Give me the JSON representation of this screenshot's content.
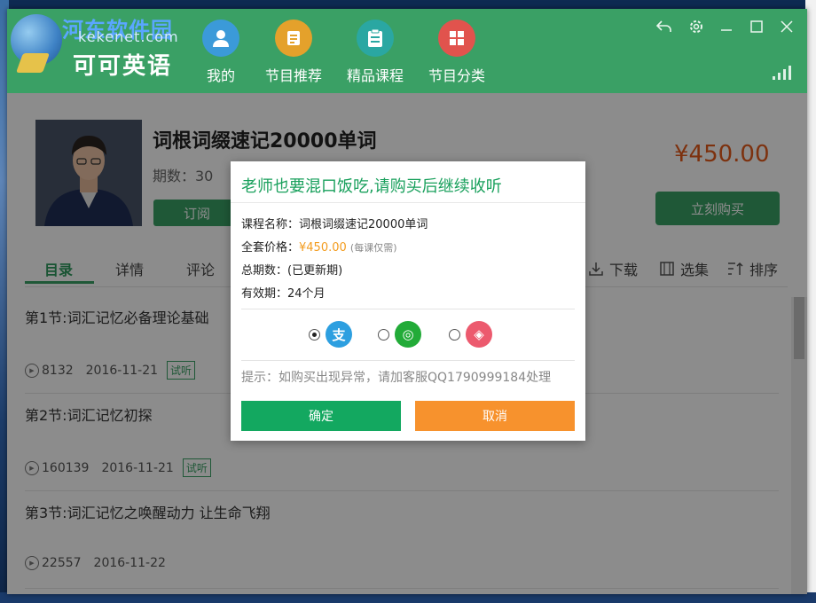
{
  "brand": {
    "site_name": "河东软件园",
    "site_url": "kekenet.com",
    "app_name": "可可英语"
  },
  "nav": [
    {
      "label": "我的",
      "icon": "user-icon",
      "color": "#3b9ad9"
    },
    {
      "label": "节目推荐",
      "icon": "list-icon",
      "color": "#e4a12b"
    },
    {
      "label": "精品课程",
      "icon": "clipboard-icon",
      "color": "#2aa7a2"
    },
    {
      "label": "节目分类",
      "icon": "windows-icon",
      "color": "#e1534d"
    }
  ],
  "window_controls": [
    "back-icon",
    "gear-icon",
    "minimize-icon",
    "maximize-icon",
    "close-icon"
  ],
  "course": {
    "title": "词根词缀速记20000单词",
    "periods": "期数：30",
    "subscribe_label": "订阅",
    "price": "¥450.00",
    "buy_label": "立刻购买"
  },
  "tabs": [
    {
      "label": "目录",
      "active": true
    },
    {
      "label": "详情",
      "active": false
    },
    {
      "label": "评论",
      "active": false
    }
  ],
  "tools": [
    {
      "label": "下载",
      "icon": "download-icon"
    },
    {
      "label": "选集",
      "icon": "select-icon"
    },
    {
      "label": "排序",
      "icon": "sort-icon"
    }
  ],
  "lessons": [
    {
      "title": "第1节:词汇记忆必备理论基础",
      "plays": "8132",
      "date": "2016-11-21",
      "badge": "试听"
    },
    {
      "title": "第2节:词汇记忆初探",
      "plays": "160139",
      "date": "2016-11-21",
      "badge": "试听"
    },
    {
      "title": "第3节:词汇记忆之唤醒动力 让生命飞翔",
      "plays": "22557",
      "date": "2016-11-22",
      "badge": ""
    }
  ],
  "modal": {
    "title": "老师也要混口饭吃,请购买后继续收听",
    "course_name_label": "课程名称：",
    "course_name_value": "词根词缀速记20000单词",
    "full_price_label": "全套价格：",
    "full_price_value": "¥450.00",
    "full_price_note": "(每课仅需)",
    "total_periods_label": "总期数：",
    "total_periods_value": "(已更新期)",
    "validity_label": "有效期：",
    "validity_value": "24个月",
    "payment_methods": [
      {
        "name": "alipay",
        "icon": "alipay-icon",
        "glyph": "支",
        "color": "#2d9fe0",
        "selected": true
      },
      {
        "name": "wechat",
        "icon": "wechat-pay-icon",
        "glyph": "◎",
        "color": "#22ab38",
        "selected": false
      },
      {
        "name": "other",
        "icon": "card-pay-icon",
        "glyph": "◈",
        "color": "#ec5a6e",
        "selected": false
      }
    ],
    "tip": "提示：如购买出现异常，请加客服QQ1790999184处理",
    "ok_label": "确定",
    "cancel_label": "取消"
  }
}
